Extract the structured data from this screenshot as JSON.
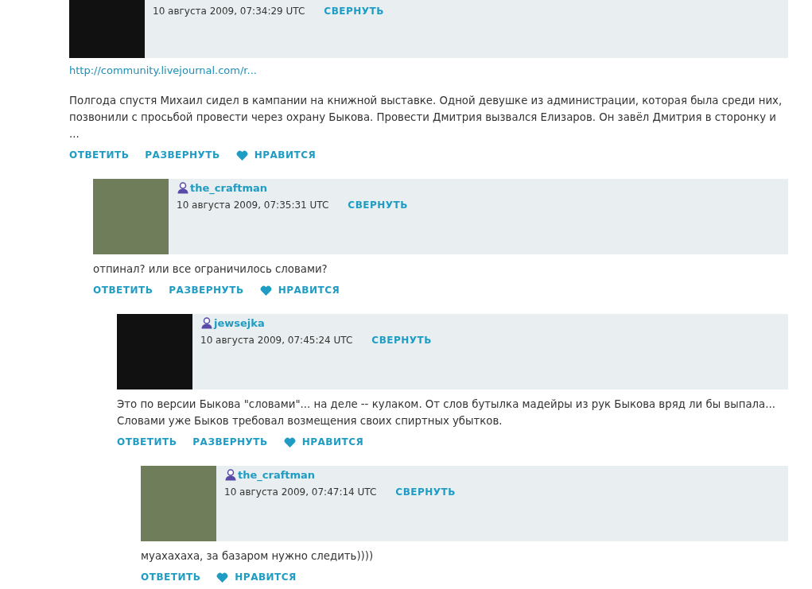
{
  "comments": [
    {
      "avatar": {
        "color": "#111111"
      },
      "date": "10 августа 2009, 07:34:29 UTC",
      "collapse": "СВЕРНУТЬ",
      "link": "http://community.livejournal.com/r...",
      "body": "Полгода спустя Михаил сидел в кампании на книжной выставке. Одной девушке из администрации, которая была среди них, позвонили с просьбой провести через охрану Быкова. Провести Дмитрия вызвался Елизаров. Он завёл Дмитрия в сторонку и ...",
      "actions": [
        {
          "kind": "reply",
          "label": "ОТВЕТИТЬ"
        },
        {
          "kind": "expand",
          "label": "РАЗВЕРНУТЬ"
        },
        {
          "kind": "like",
          "label": "НРАВИТСЯ"
        }
      ],
      "children": [
        {
          "avatar": {
            "color": "#6f7d5a"
          },
          "user": "the_craftman",
          "date": "10 августа 2009, 07:35:31 UTC",
          "collapse": "СВЕРНУТЬ",
          "body": "отпинал? или все ограничилось словами?",
          "actions": [
            {
              "kind": "reply",
              "label": "ОТВЕТИТЬ"
            },
            {
              "kind": "expand",
              "label": "РАЗВЕРНУТЬ"
            },
            {
              "kind": "like",
              "label": "НРАВИТСЯ"
            }
          ],
          "children": [
            {
              "avatar": {
                "color": "#111111"
              },
              "user": "jewsejka",
              "date": "10 августа 2009, 07:45:24 UTC",
              "collapse": "СВЕРНУТЬ",
              "body": "Это по версии Быкова \"словами\"... на деле -- кулаком. От слов бутылка мадейры из рук Быкова вряд ли бы выпала... Словами уже Быков требовал возмещения своих спиртных убытков.",
              "actions": [
                {
                  "kind": "reply",
                  "label": "ОТВЕТИТЬ"
                },
                {
                  "kind": "expand",
                  "label": "РАЗВЕРНУТЬ"
                },
                {
                  "kind": "like",
                  "label": "НРАВИТСЯ"
                }
              ],
              "children": [
                {
                  "avatar": {
                    "color": "#6f7d5a"
                  },
                  "user": "the_craftman",
                  "date": "10 августа 2009, 07:47:14 UTC",
                  "collapse": "СВЕРНУТЬ",
                  "body": "муахахаха, за базаром нужно следить))))",
                  "actions": [
                    {
                      "kind": "reply",
                      "label": "ОТВЕТИТЬ"
                    },
                    {
                      "kind": "like",
                      "label": "НРАВИТСЯ"
                    }
                  ]
                }
              ]
            }
          ]
        }
      ]
    }
  ]
}
